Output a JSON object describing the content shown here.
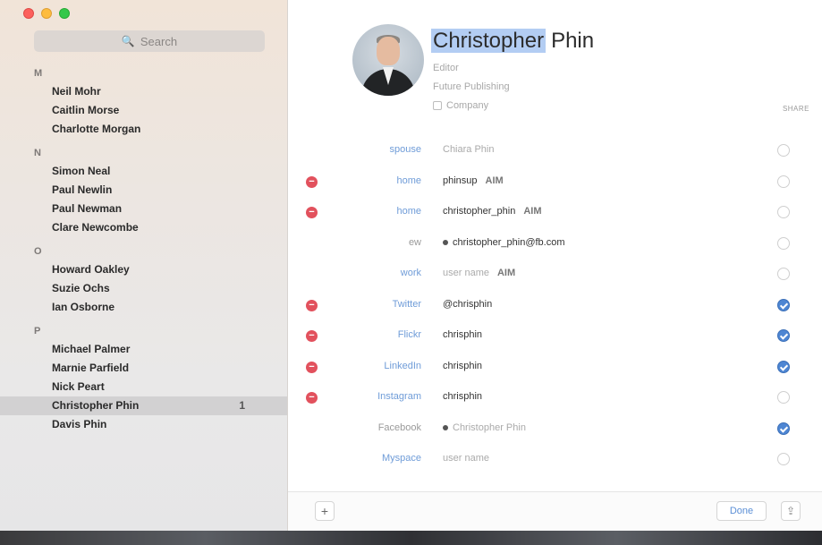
{
  "window": {
    "title": ""
  },
  "sidebar": {
    "search_placeholder": "Search",
    "sections": [
      {
        "letter": "M",
        "contacts": [
          {
            "name": "Neil Mohr"
          },
          {
            "name": "Caitlin Morse"
          },
          {
            "name": "Charlotte Morgan"
          }
        ]
      },
      {
        "letter": "N",
        "contacts": [
          {
            "name": "Simon Neal"
          },
          {
            "name": "Paul Newlin"
          },
          {
            "name": "Paul Newman"
          },
          {
            "name": "Clare Newcombe"
          }
        ]
      },
      {
        "letter": "O",
        "contacts": [
          {
            "name": "Howard Oakley"
          },
          {
            "name": "Suzie Ochs"
          },
          {
            "name": "Ian Osborne"
          }
        ]
      },
      {
        "letter": "P",
        "contacts": [
          {
            "name": "Michael Palmer"
          },
          {
            "name": "Marnie Parfield"
          },
          {
            "name": "Nick Peart"
          },
          {
            "name": "Christopher Phin",
            "selected": true,
            "badge": "1"
          },
          {
            "name": "Davis Phin"
          }
        ]
      }
    ]
  },
  "card": {
    "first_name": "Christopher",
    "last_name": "Phin",
    "job_title": "Editor",
    "company": "Future Publishing",
    "company_checkbox_label": "Company",
    "share_column_header": "SHARE"
  },
  "fields": [
    {
      "label": "spouse",
      "value": "Chiara Phin",
      "value_faded": true,
      "deletable": false,
      "label_gray": false,
      "accessory": "",
      "bullet": false,
      "shared": false
    },
    {
      "label": "home",
      "value": "phinsup",
      "value_faded": false,
      "deletable": true,
      "label_gray": false,
      "accessory": "AIM",
      "bullet": false,
      "shared": false
    },
    {
      "label": "home",
      "value": "christopher_phin",
      "value_faded": false,
      "deletable": true,
      "label_gray": false,
      "accessory": "AIM",
      "bullet": false,
      "shared": false
    },
    {
      "label": "ew",
      "value": "christopher_phin@fb.com",
      "value_faded": false,
      "deletable": false,
      "label_gray": true,
      "accessory": "",
      "bullet": true,
      "shared": false
    },
    {
      "label": "work",
      "value": "user name",
      "value_faded": true,
      "deletable": false,
      "label_gray": false,
      "accessory": "AIM",
      "bullet": false,
      "shared": false
    },
    {
      "label": "Twitter",
      "value": "@chrisphin",
      "value_faded": false,
      "deletable": true,
      "label_gray": false,
      "accessory": "",
      "bullet": false,
      "shared": true
    },
    {
      "label": "Flickr",
      "value": "chrisphin",
      "value_faded": false,
      "deletable": true,
      "label_gray": false,
      "accessory": "",
      "bullet": false,
      "shared": true
    },
    {
      "label": "LinkedIn",
      "value": "chrisphin",
      "value_faded": false,
      "deletable": true,
      "label_gray": false,
      "accessory": "",
      "bullet": false,
      "shared": true
    },
    {
      "label": "Instagram",
      "value": "chrisphin",
      "value_faded": false,
      "deletable": true,
      "label_gray": false,
      "accessory": "",
      "bullet": false,
      "shared": false
    },
    {
      "label": "Facebook",
      "value": "Christopher Phin",
      "value_faded": true,
      "deletable": false,
      "label_gray": true,
      "accessory": "",
      "bullet": true,
      "shared": true
    },
    {
      "label": "Myspace",
      "value": "user name",
      "value_faded": true,
      "deletable": false,
      "label_gray": false,
      "accessory": "",
      "bullet": false,
      "shared": false
    }
  ],
  "footer": {
    "add_label": "+",
    "done_label": "Done",
    "share_label": "⇪"
  },
  "colors": {
    "accent": "#4e86d3",
    "delete": "#e2515d",
    "label_blue": "#6f9cd8",
    "selection": "#b3cdf3"
  }
}
